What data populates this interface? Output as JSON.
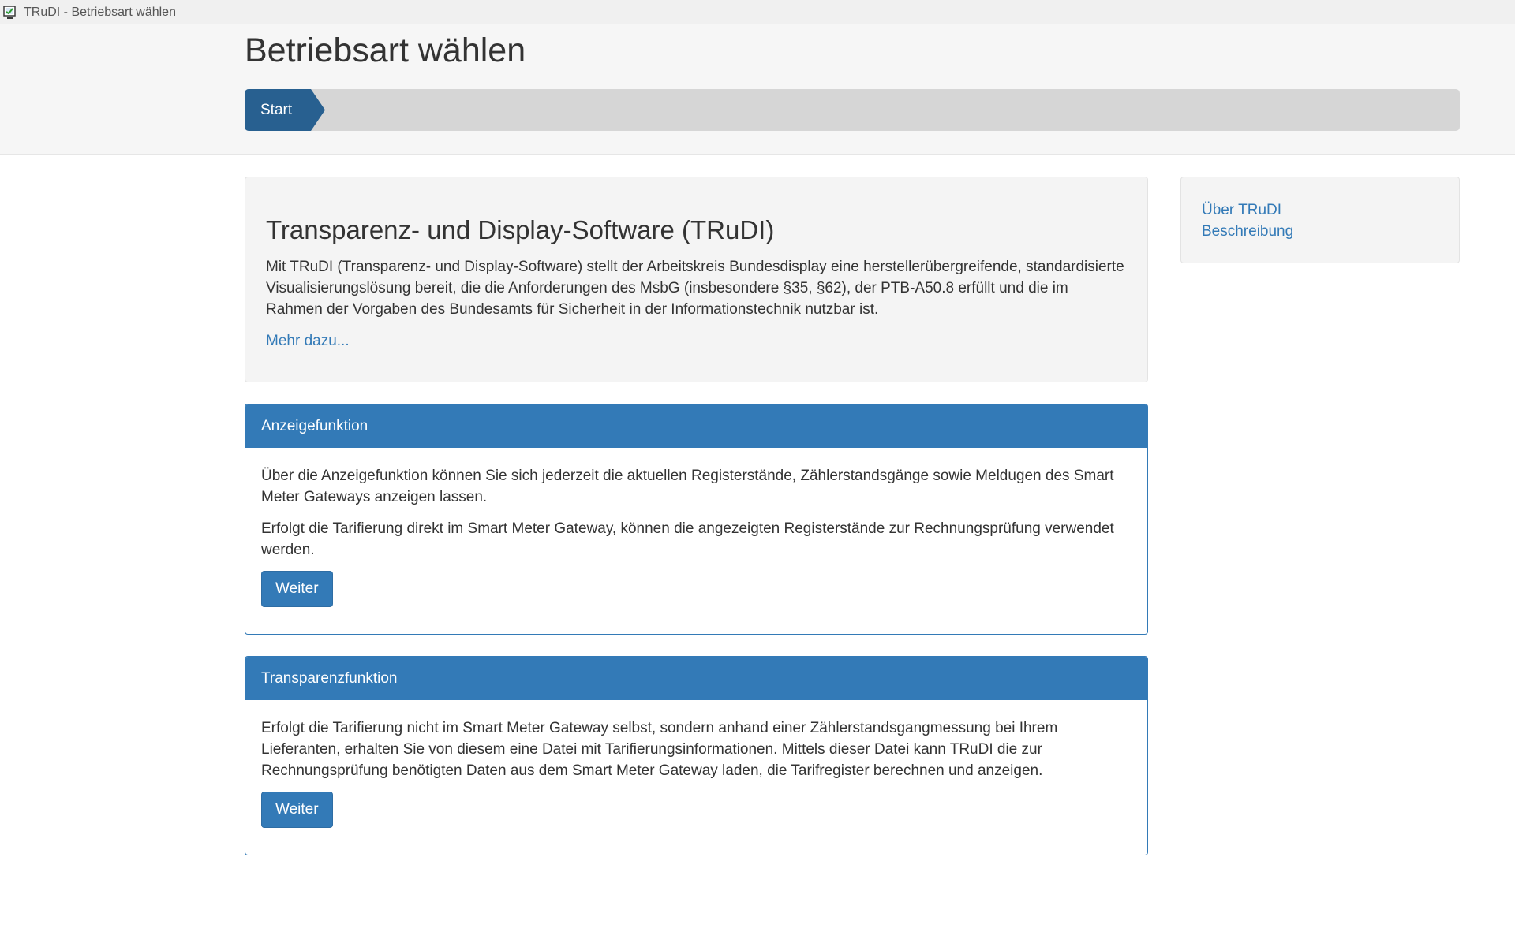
{
  "window": {
    "title": "TRuDI - Betriebsart wählen"
  },
  "header": {
    "title": "Betriebsart wählen",
    "progress_steps": [
      {
        "label": "Start"
      }
    ]
  },
  "intro": {
    "title": "Transparenz- und Display-Software (TRuDI)",
    "text": "Mit TRuDI (Transparenz- und Display-Software) stellt der Arbeitskreis Bundesdisplay eine herstellerübergreifende, standardisierte Visualisierungslösung bereit, die die Anforderungen des MsbG (insbesondere §35, §62), der PTB-A50.8 erfüllt und die im Rahmen der Vorgaben des Bundesamts für Sicherheit in der Informationstechnik nutzbar ist.",
    "more_link": "Mehr dazu..."
  },
  "panels": [
    {
      "title": "Anzeigefunktion",
      "paragraphs": [
        "Über die Anzeigefunktion können Sie sich jederzeit die aktuellen Registerstände, Zählerstandsgänge sowie Meldugen des Smart Meter Gateways anzeigen lassen.",
        "Erfolgt die Tarifierung direkt im Smart Meter Gateway, können die angezeigten Registerstände zur Rechnungsprüfung verwendet werden."
      ],
      "button": "Weiter"
    },
    {
      "title": "Transparenzfunktion",
      "paragraphs": [
        "Erfolgt die Tarifierung nicht im Smart Meter Gateway selbst, sondern anhand einer Zählerstandsgangmessung bei Ihrem Lieferanten, erhalten Sie von diesem eine Datei mit Tarifierungsinformationen. Mittels dieser Datei kann TRuDI die zur Rechnungsprüfung benötigten Daten aus dem Smart Meter Gateway laden, die Tarifregister berechnen und anzeigen."
      ],
      "button": "Weiter"
    }
  ],
  "sidebar": {
    "links": [
      {
        "label": "Über TRuDI"
      },
      {
        "label": "Beschreibung"
      }
    ]
  },
  "colors": {
    "primary": "#337ab7",
    "step_active": "#286090",
    "progress_track": "#d6d6d6"
  },
  "icons": {
    "app": "trudi-app-icon"
  }
}
